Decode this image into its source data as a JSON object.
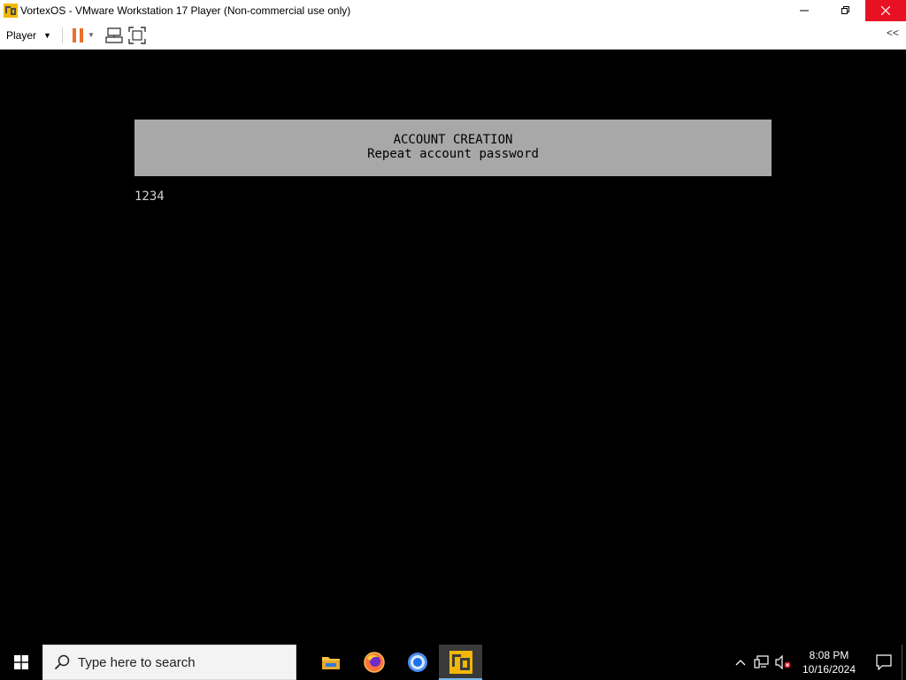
{
  "window": {
    "title": "VortexOS - VMware Workstation 17 Player (Non-commercial use only)"
  },
  "toolbar": {
    "player_label": "Player",
    "collapse_label": "<<"
  },
  "vm": {
    "banner_title": "ACCOUNT CREATION",
    "banner_subtitle": "Repeat account password",
    "typed_text": "1234"
  },
  "taskbar": {
    "search_placeholder": "Type here to search",
    "apps": [
      "file-explorer",
      "firefox",
      "chrome",
      "vmware-player"
    ],
    "time": "8:08 PM",
    "date": "10/16/2024"
  },
  "colors": {
    "close_button": "#e81123",
    "banner_bg": "#a8a8a8",
    "pause_icon": "#e8702a",
    "active_app_underline": "#76b9ed"
  }
}
